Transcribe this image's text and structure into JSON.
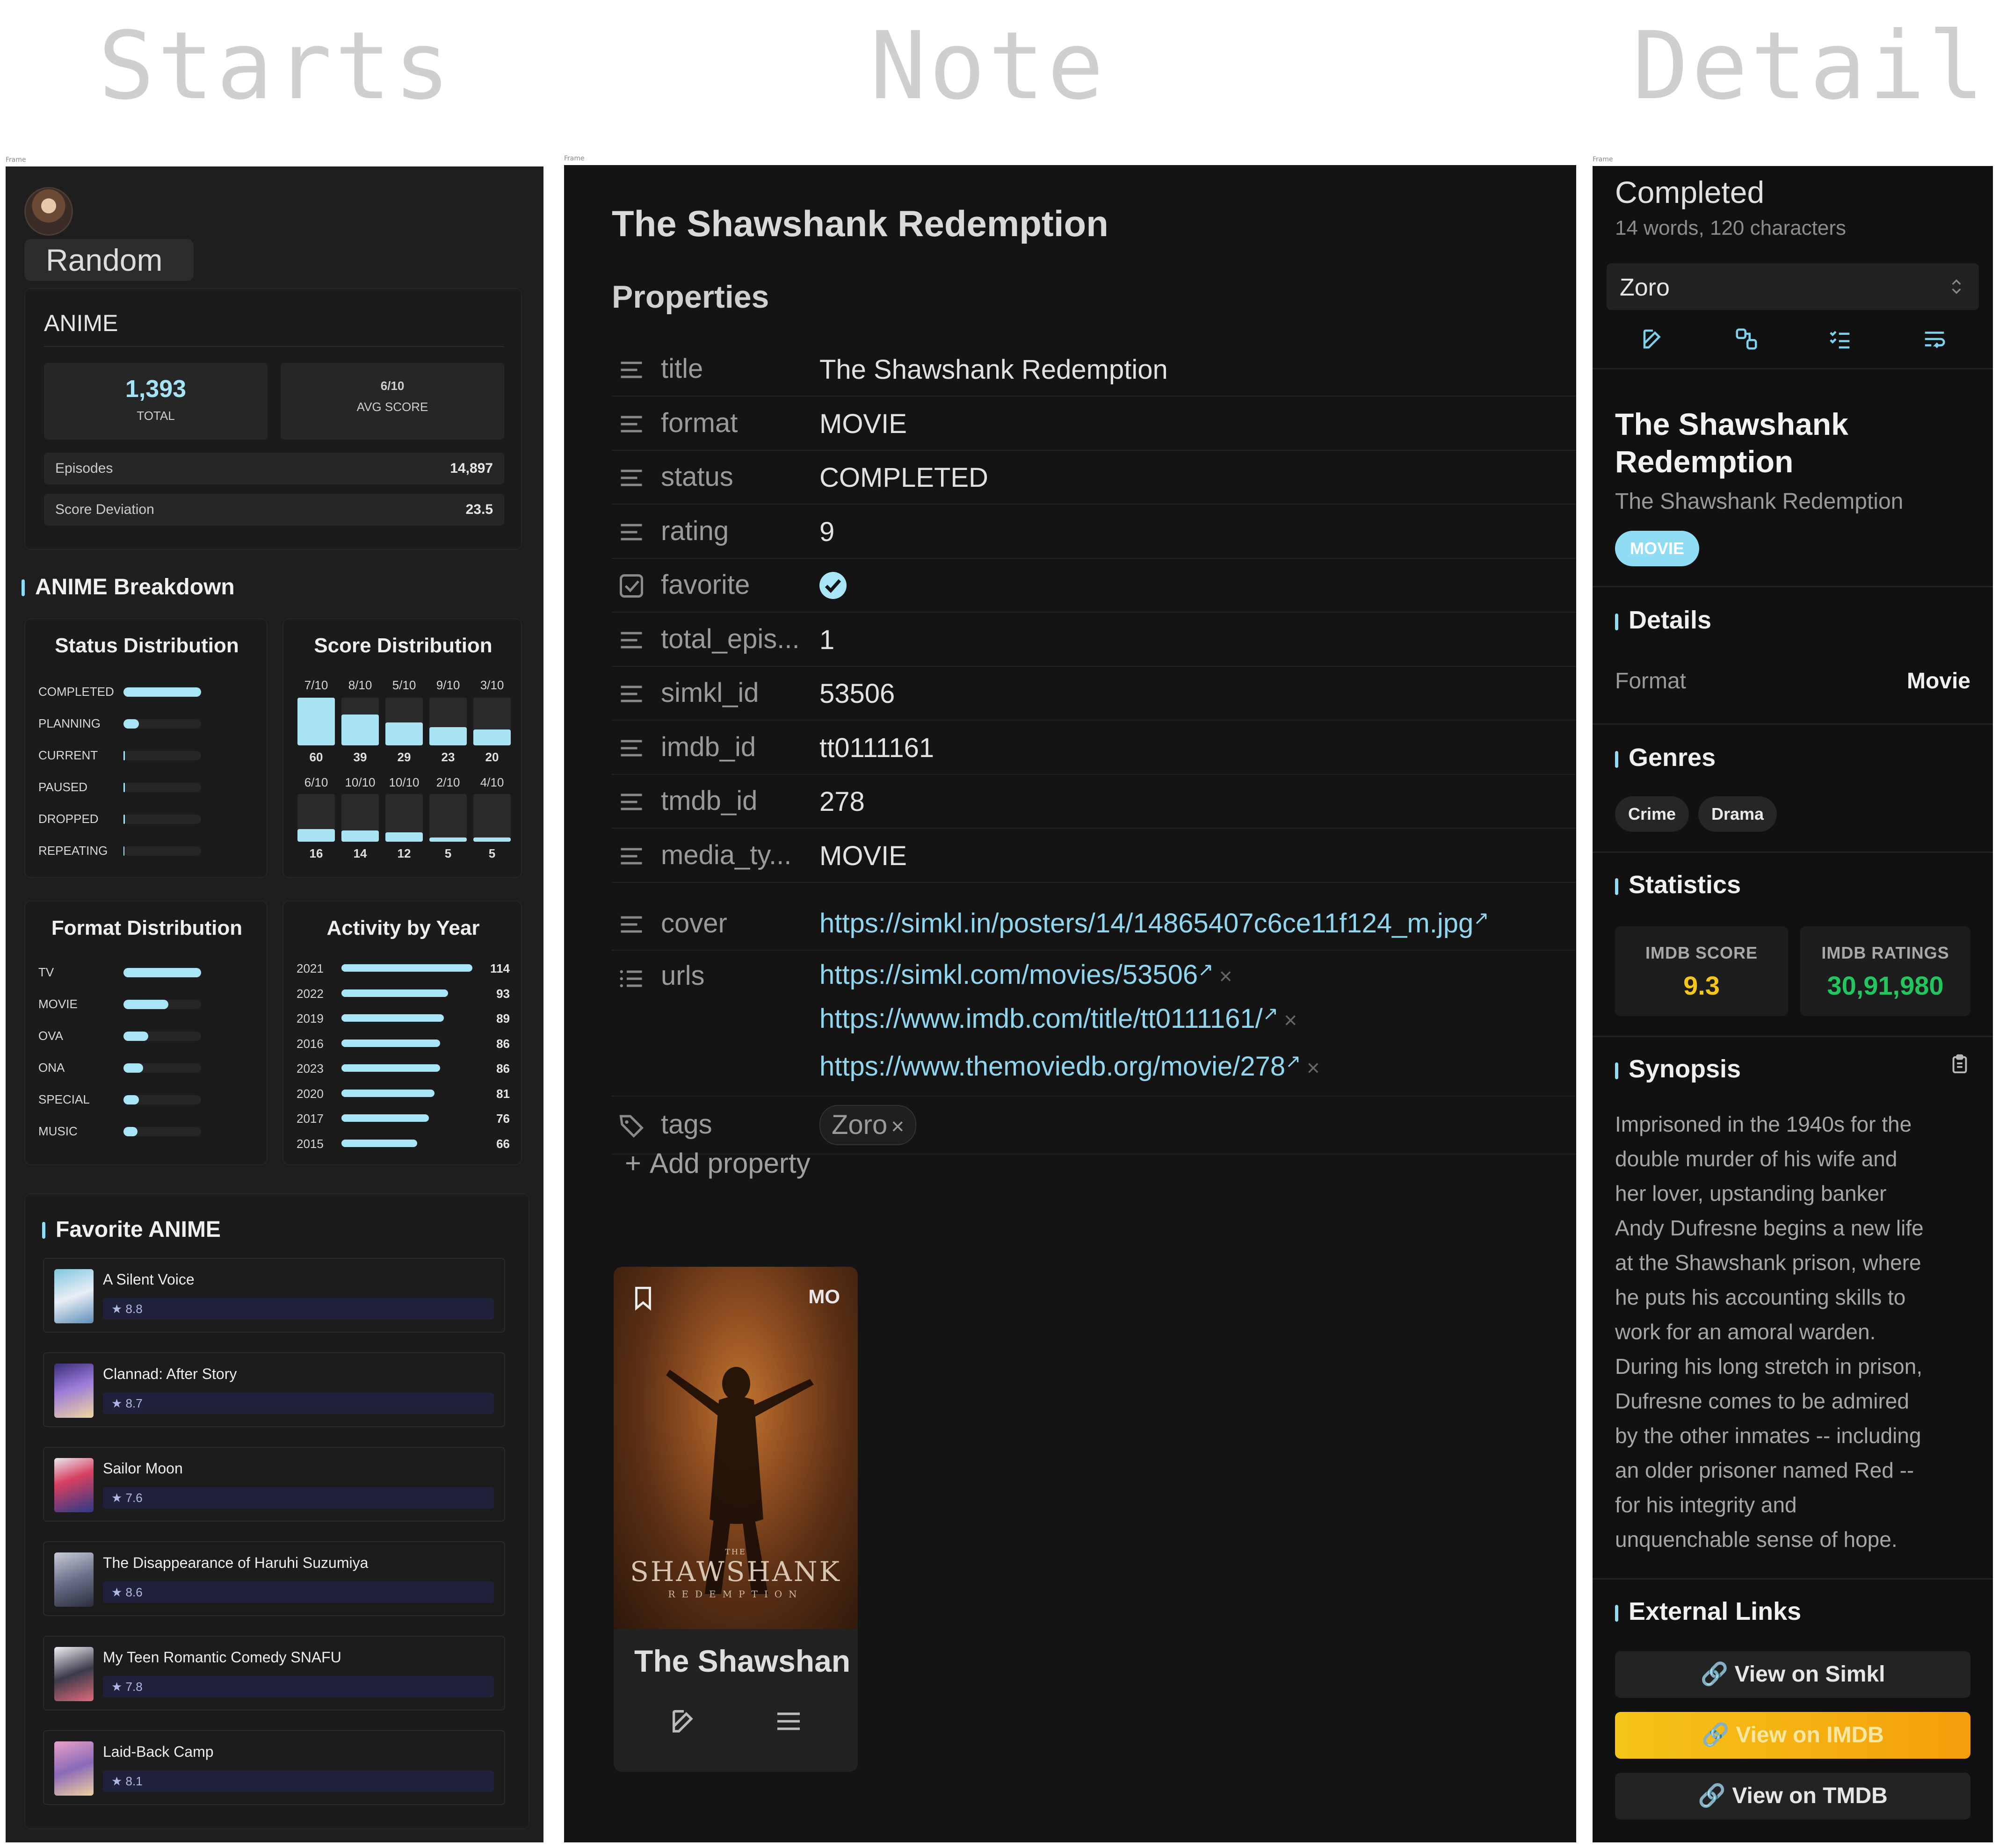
{
  "headings": {
    "starts": "Starts",
    "note": "Note",
    "detail": "Detail"
  },
  "frame_label": "Frame",
  "starts": {
    "random_label": "Random",
    "summary": {
      "title": "ANIME",
      "total_value": "1,393",
      "total_label": "TOTAL",
      "avg_value": "6/10",
      "avg_label": "AVG SCORE",
      "episodes_label": "Episodes",
      "episodes_value": "14,897",
      "deviation_label": "Score Deviation",
      "deviation_value": "23.5"
    },
    "breakdown_title": "ANIME Breakdown",
    "status_distribution": {
      "title": "Status Distribution",
      "items": [
        {
          "label": "COMPLETED",
          "fraction": 1.0
        },
        {
          "label": "PLANNING",
          "fraction": 0.2
        },
        {
          "label": "CURRENT",
          "fraction": 0.02
        },
        {
          "label": "PAUSED",
          "fraction": 0.02
        },
        {
          "label": "DROPPED",
          "fraction": 0.02
        },
        {
          "label": "REPEATING",
          "fraction": 0.0
        }
      ]
    },
    "score_distribution": {
      "title": "Score Distribution",
      "top": [
        {
          "label": "7/10",
          "count": "60",
          "value": 60
        },
        {
          "label": "8/10",
          "count": "39",
          "value": 39
        },
        {
          "label": "5/10",
          "count": "29",
          "value": 29
        },
        {
          "label": "9/10",
          "count": "23",
          "value": 23
        },
        {
          "label": "3/10",
          "count": "20",
          "value": 20
        }
      ],
      "bottom": [
        {
          "label": "6/10",
          "count": "16",
          "value": 16
        },
        {
          "label": "10/10",
          "count": "14",
          "value": 14
        },
        {
          "label": "10/10",
          "count": "12",
          "value": 12
        },
        {
          "label": "2/10",
          "count": "5",
          "value": 5
        },
        {
          "label": "4/10",
          "count": "5",
          "value": 5
        }
      ]
    },
    "format_distribution": {
      "title": "Format Distribution",
      "items": [
        {
          "label": "TV",
          "fraction": 1.0
        },
        {
          "label": "MOVIE",
          "fraction": 0.58
        },
        {
          "label": "OVA",
          "fraction": 0.32
        },
        {
          "label": "ONA",
          "fraction": 0.25
        },
        {
          "label": "SPECIAL",
          "fraction": 0.2
        },
        {
          "label": "MUSIC",
          "fraction": 0.18
        }
      ]
    },
    "activity_by_year": {
      "title": "Activity by Year",
      "items": [
        {
          "year": "2021",
          "count": "114",
          "value": 114
        },
        {
          "year": "2022",
          "count": "93",
          "value": 93
        },
        {
          "year": "2019",
          "count": "89",
          "value": 89
        },
        {
          "year": "2016",
          "count": "86",
          "value": 86
        },
        {
          "year": "2023",
          "count": "86",
          "value": 86
        },
        {
          "year": "2020",
          "count": "81",
          "value": 81
        },
        {
          "year": "2017",
          "count": "76",
          "value": 76
        },
        {
          "year": "2015",
          "count": "66",
          "value": 66
        }
      ]
    },
    "favorites": {
      "title": "Favorite ANIME",
      "items": [
        {
          "name": "A Silent Voice",
          "score": "★ 8.8"
        },
        {
          "name": "Clannad: After Story",
          "score": "★ 8.7"
        },
        {
          "name": "Sailor Moon",
          "score": "★ 7.6"
        },
        {
          "name": "The Disappearance of Haruhi Suzumiya",
          "score": "★ 8.6"
        },
        {
          "name": "My Teen Romantic Comedy SNAFU",
          "score": "★ 7.8"
        },
        {
          "name": "Laid-Back Camp",
          "score": "★ 8.1"
        }
      ]
    }
  },
  "note": {
    "title": "The Shawshank Redemption",
    "properties_label": "Properties",
    "properties": [
      {
        "key": "title",
        "value": "The Shawshank Redemption",
        "icon": "text-lines-icon"
      },
      {
        "key": "format",
        "value": "MOVIE",
        "icon": "text-lines-icon"
      },
      {
        "key": "status",
        "value": "COMPLETED",
        "icon": "text-lines-icon"
      },
      {
        "key": "rating",
        "value": "9",
        "icon": "text-lines-icon"
      },
      {
        "key": "favorite",
        "value": "",
        "icon": "checkbox-icon"
      },
      {
        "key": "total_epis...",
        "value": "1",
        "icon": "text-lines-icon"
      },
      {
        "key": "simkl_id",
        "value": "53506",
        "icon": "text-lines-icon"
      },
      {
        "key": "imdb_id",
        "value": "tt0111161",
        "icon": "text-lines-icon"
      },
      {
        "key": "tmdb_id",
        "value": "278",
        "icon": "text-lines-icon"
      },
      {
        "key": "media_ty...",
        "value": "MOVIE",
        "icon": "text-lines-icon"
      }
    ],
    "cover": {
      "key": "cover",
      "value": "https://simkl.in/posters/14/14865407c6ce11f124_m.jpg"
    },
    "urls": {
      "key": "urls",
      "values": [
        "https://simkl.com/movies/53506",
        "https://www.imdb.com/title/tt0111161/",
        "https://www.themoviedb.org/movie/278"
      ]
    },
    "tags": {
      "key": "tags",
      "values": [
        "Zoro"
      ]
    },
    "add_property": "Add property",
    "card": {
      "badge": "MO",
      "title": "The Shawshanl",
      "poster_text": "SHAWSHANK",
      "poster_pre": "THE",
      "poster_sub": "REDEMPTION"
    }
  },
  "detail": {
    "status_title": "Completed",
    "word_count": "14 words, 120 characters",
    "selector_value": "Zoro",
    "title": "The Shawshank Redemption",
    "subtitle": "The Shawshank Redemption",
    "format_badge": "MOVIE",
    "details_label": "Details",
    "format_label": "Format",
    "format_value": "Movie",
    "genres_label": "Genres",
    "genres": [
      "Crime",
      "Drama"
    ],
    "statistics_label": "Statistics",
    "imdb_score_label": "IMDB SCORE",
    "imdb_score_value": "9.3",
    "imdb_ratings_label": "IMDB RATINGS",
    "imdb_ratings_value": "30,91,980",
    "synopsis_label": "Synopsis",
    "synopsis": "Imprisoned in the 1940s for the double murder of his wife and her lover, upstanding banker Andy Dufresne begins a new life at the Shawshank prison, where he puts his accounting skills to work for an amoral warden. During his long stretch in prison, Dufresne comes to be admired by the other inmates -- including an older prisoner named Red -- for his integrity and unquenchable sense of hope.",
    "external_links_label": "External Links",
    "links": [
      "🔗 View on Simkl",
      "🔗 View on IMDB",
      "🔗 View on TMDB"
    ]
  },
  "colors": {
    "accent": "#8fdcf5",
    "imdb_score": "#f5c518",
    "imdb_ratings": "#22c55e",
    "imdb_button": "#f5b81a"
  }
}
